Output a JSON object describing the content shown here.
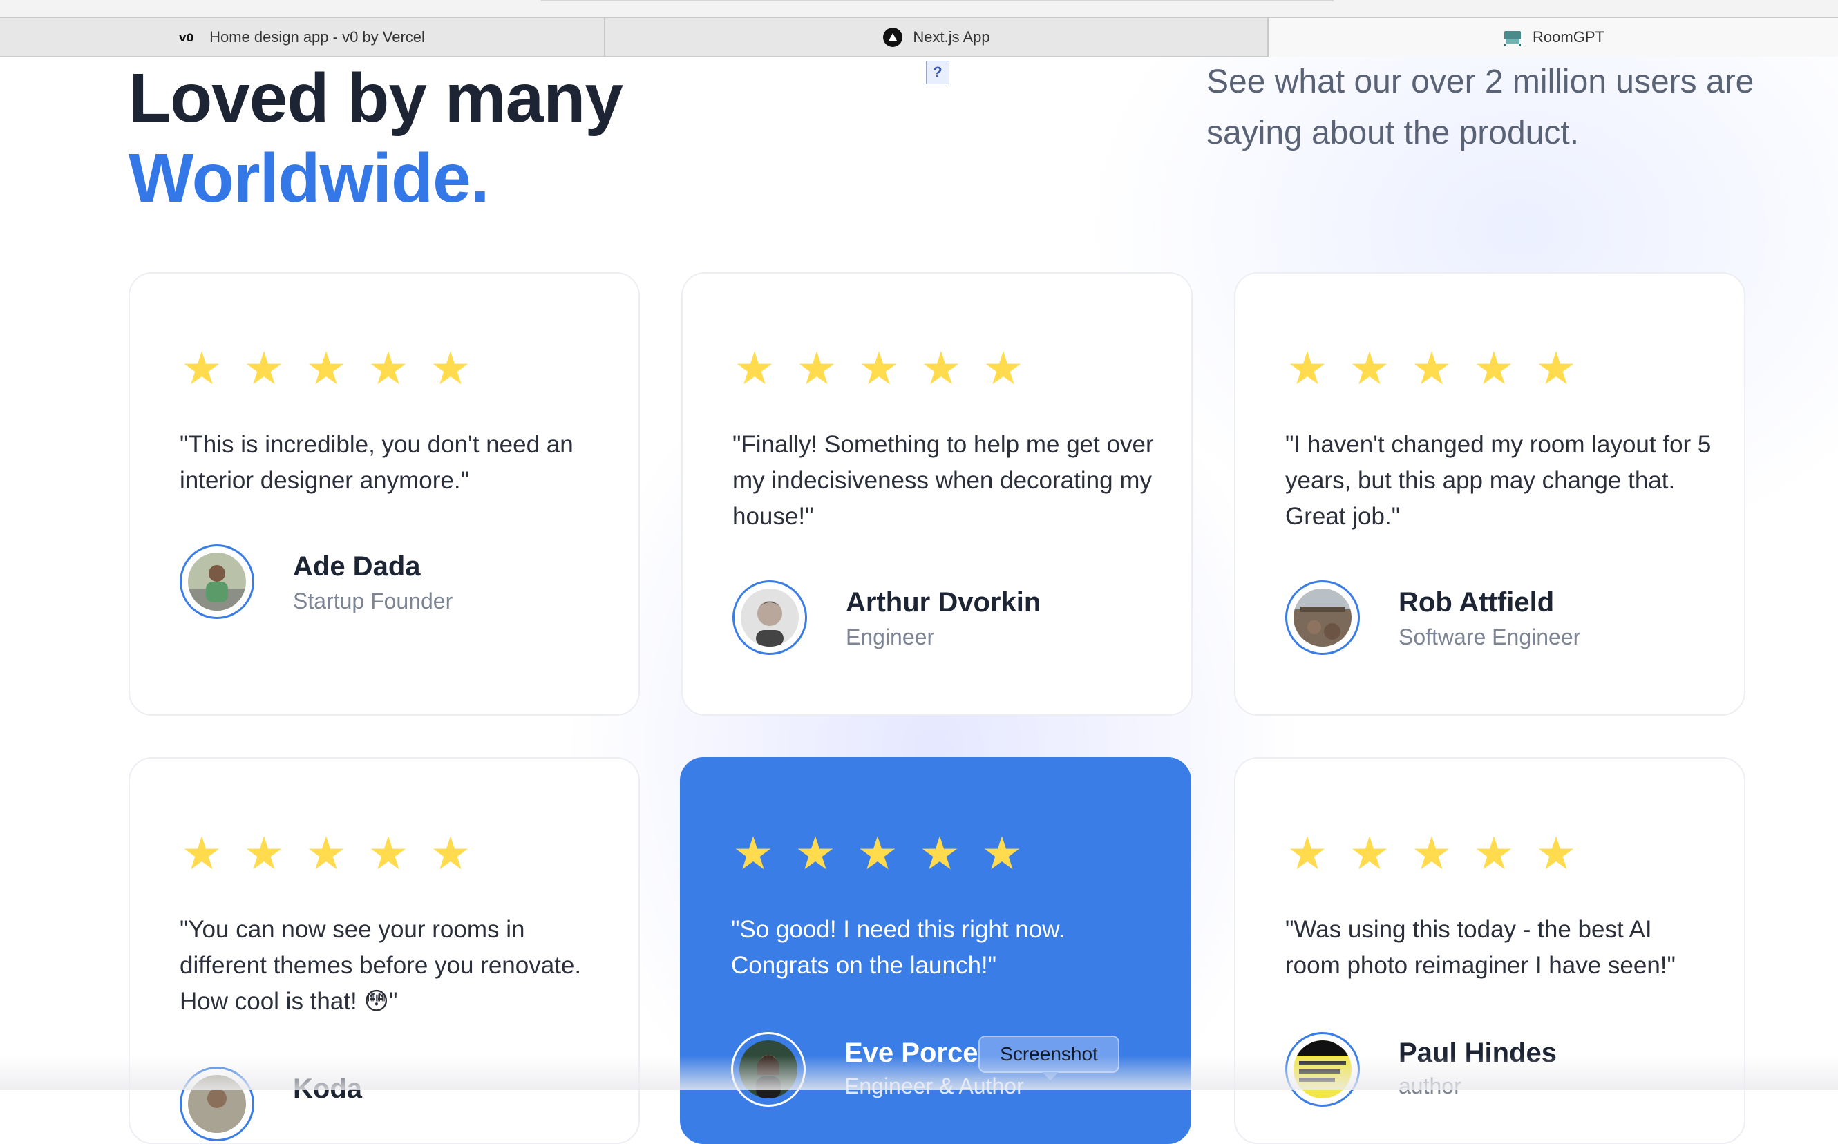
{
  "browser": {
    "tabs": [
      {
        "label": "Home design app - v0 by Vercel",
        "icon": "v0-logo-icon"
      },
      {
        "label": "Next.js App",
        "icon": "nextjs-logo-icon"
      },
      {
        "label": "RoomGPT",
        "icon": "roomgpt-logo-icon"
      }
    ],
    "active_tab": 2
  },
  "section": {
    "headline_line1": "Loved by many",
    "headline_line2": "Worldwide.",
    "subtext": "See what our over 2 million users are saying about the product.",
    "broken_image_glyph": "?"
  },
  "colors": {
    "accent": "#3478e8",
    "featured_card": "#3b7de6",
    "star": "#ffdb4d",
    "heading": "#1d2433"
  },
  "star_glyph": "★",
  "testimonials": [
    {
      "rating": 5,
      "quote": "\"This is incredible, you don't need an interior designer anymore.\"",
      "name": "Ade Dada",
      "role": "Startup Founder",
      "featured": false
    },
    {
      "rating": 5,
      "quote": "\"Finally! Something to help me get over my indecisiveness when decorating my house!\"",
      "name": "Arthur Dvorkin",
      "role": "Engineer",
      "featured": false
    },
    {
      "rating": 5,
      "quote": "\"I haven't changed my room layout for 5 years, but this app may change that. Great job.\"",
      "name": "Rob Attfield",
      "role": "Software Engineer",
      "featured": false
    },
    {
      "rating": 5,
      "quote": "\"You can now see your rooms in different themes before you renovate. How cool is that! 😳\"",
      "name": "Koda",
      "role": "",
      "featured": false
    },
    {
      "rating": 5,
      "quote": "\"So good! I need this right now. Congrats on the launch!\"",
      "name": "Eve Porcello",
      "role": "Engineer & Author",
      "featured": true
    },
    {
      "rating": 5,
      "quote": "\"Was using this today - the best AI room photo reimaginer I have seen!\"",
      "name": "Paul Hindes",
      "role": "author",
      "featured": false
    }
  ],
  "tooltip": {
    "label": "Screenshot"
  }
}
